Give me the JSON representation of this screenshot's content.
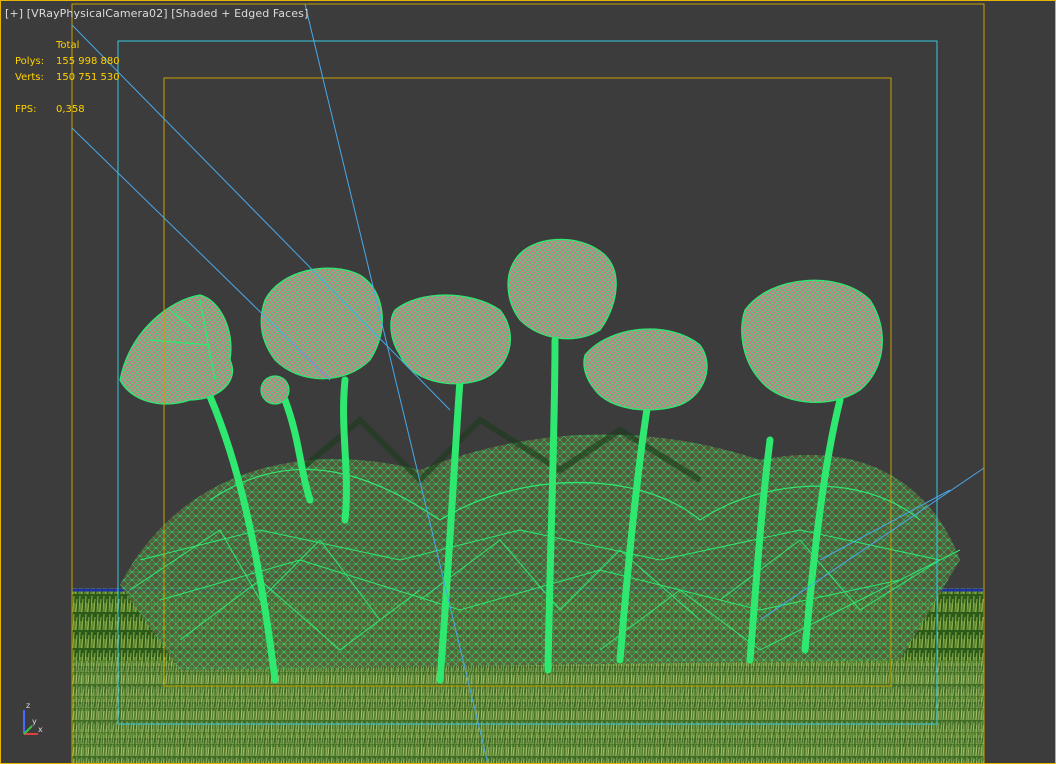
{
  "viewport": {
    "label_parts": [
      "[+]",
      "[VRayPhysicalCamera02]",
      "[Shaded + Edged Faces]"
    ],
    "stats": {
      "header": "Total",
      "rows": [
        {
          "key": "Polys:",
          "value": "155 998 880"
        },
        {
          "key": "Verts:",
          "value": "150 751 530"
        },
        {
          "key": "",
          "value": ""
        },
        {
          "key": "FPS:",
          "value": "0,358"
        }
      ]
    },
    "axis": {
      "x": "x",
      "y": "y",
      "z": "z"
    }
  },
  "colors": {
    "background": "#3c3c3c",
    "active_border": "#e6b400",
    "safe_frame_outer": "#c8a000",
    "safe_frame_action": "#38c8e0",
    "safe_frame_title": "#c8a000",
    "camera_lines": "#4aa8e8",
    "wireframe": "#2ee870",
    "grass": "#2a5a1a",
    "petal": "#e08a98",
    "stats_text": "#ffd200"
  }
}
